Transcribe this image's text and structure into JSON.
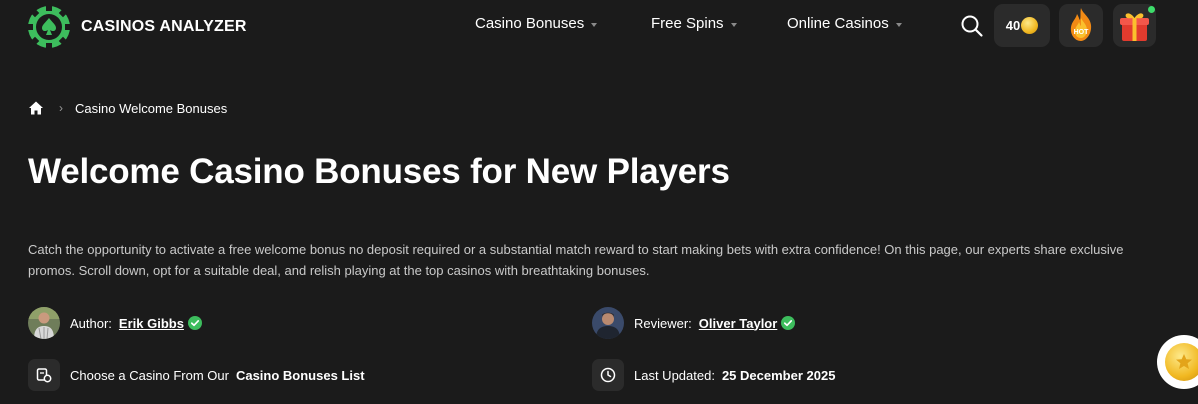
{
  "header": {
    "logo_text": "CASINOS ANALYZER",
    "nav": [
      {
        "label": "Casino Bonuses"
      },
      {
        "label": "Free Spins"
      },
      {
        "label": "Online Casinos"
      }
    ],
    "coins_count": "40",
    "hot_label": "HOT",
    "accent_color": "#3dbd5d"
  },
  "breadcrumb": {
    "current": "Casino Welcome Bonuses"
  },
  "page": {
    "title": "Welcome Casino Bonuses for New Players",
    "description": "Catch the opportunity to activate a free welcome bonus no deposit required or a substantial match reward to start making bets with extra confidence! On this page, our experts share exclusive promos. Scroll down, opt for a suitable deal, and relish playing at the top casinos with breathtaking bonuses."
  },
  "meta": {
    "author_label": "Author:",
    "author_name": "Erik Gibbs",
    "reviewer_label": "Reviewer:",
    "reviewer_name": "Oliver Taylor",
    "choose_text": "Choose a Casino From Our",
    "choose_link": "Casino Bonuses List",
    "updated_label": "Last Updated:",
    "updated_date": "25 December 2025"
  }
}
